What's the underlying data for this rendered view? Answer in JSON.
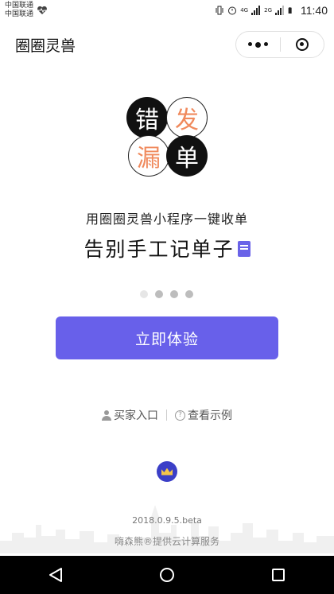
{
  "status_bar": {
    "carrier_1": "中国联通",
    "carrier_2": "中国联通",
    "network_1": "4G",
    "network_2": "2G",
    "time": "11:40"
  },
  "nav": {
    "title": "圈圈灵兽",
    "more_icon": "more-dots-icon",
    "close_icon": "target-circle-icon"
  },
  "logo": {
    "chars": [
      "错",
      "发",
      "漏",
      "单"
    ]
  },
  "hero": {
    "subtitle": "用圈圈灵兽小程序一键收单",
    "headline": "告别手工记单子"
  },
  "carousel": {
    "count": 4,
    "active_index": 0
  },
  "cta_label": "立即体验",
  "links": {
    "buyer_entry": "买家入口",
    "view_example": "查看示例"
  },
  "version": "2018.0.9.5.beta",
  "footer": "嗨森熊®提供云计算服务",
  "colors": {
    "accent": "#6860ea",
    "orange": "#f08a5d",
    "badge": "#3b3fc7"
  }
}
